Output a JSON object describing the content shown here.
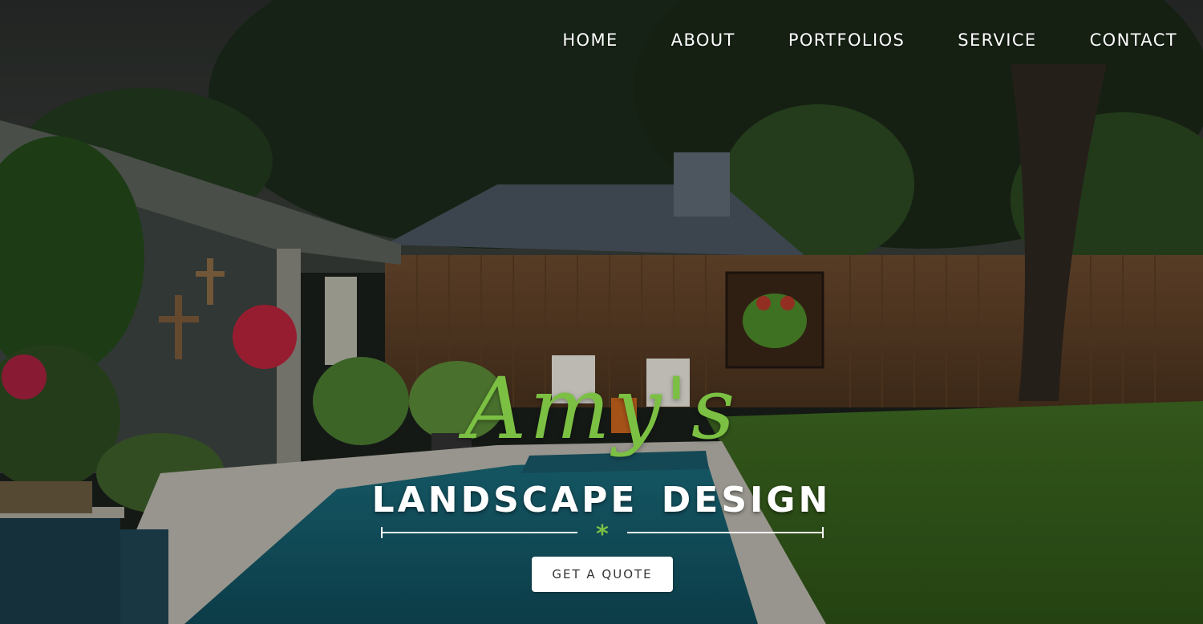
{
  "nav": {
    "items": [
      {
        "label": "HOME"
      },
      {
        "label": "ABOUT"
      },
      {
        "label": "PORTFOLIOS"
      },
      {
        "label": "SERVICE"
      },
      {
        "label": "CONTACT"
      }
    ]
  },
  "hero": {
    "script_title": "Amy's",
    "subtitle": "LANDSCAPE DESIGN",
    "divider_glyph": "*",
    "cta_label": "GET A QUOTE"
  },
  "colors": {
    "accent": "#7bc043",
    "text": "#ffffff",
    "button_bg": "#ffffff"
  },
  "icons": {
    "divider": "asterisk-divider-icon"
  }
}
